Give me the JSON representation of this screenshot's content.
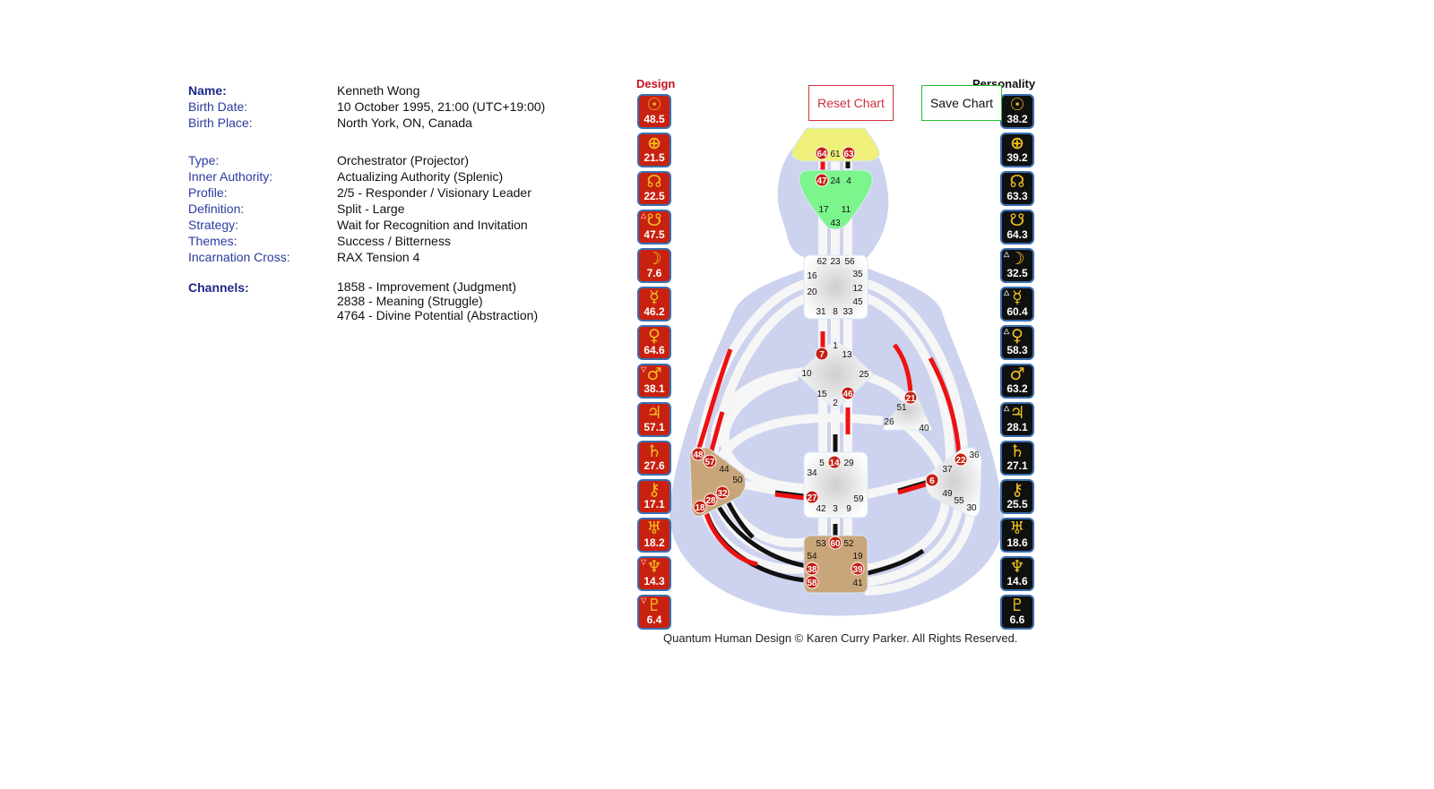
{
  "profile": {
    "name_label": "Name:",
    "name": "Kenneth Wong",
    "birth_date_label": "Birth Date:",
    "birth_date": "10 October 1995, 21:00 (UTC+19:00)",
    "birth_place_label": "Birth Place:",
    "birth_place": "North York, ON, Canada",
    "type_label": "Type:",
    "type": "Orchestrator (Projector)",
    "authority_label": "Inner Authority:",
    "authority": "Actualizing Authority (Splenic)",
    "profile_label": "Profile:",
    "profile": "2/5 - Responder / Visionary Leader",
    "definition_label": "Definition:",
    "definition": "Split - Large",
    "strategy_label": "Strategy:",
    "strategy": "Wait for Recognition and Invitation",
    "themes_label": "Themes:",
    "themes": "Success / Bitterness",
    "cross_label": "Incarnation Cross:",
    "cross": "RAX Tension 4",
    "channels_label": "Channels:",
    "channels": [
      "1858 - Improvement (Judgment)",
      "2838 - Meaning (Struggle)",
      "4764 - Divine Potential (Abstraction)"
    ]
  },
  "design": {
    "title": "Design",
    "color": "#c8210f",
    "planets": [
      {
        "name": "sun",
        "glyph": "☉",
        "value": "48.5",
        "mark": ""
      },
      {
        "name": "earth",
        "glyph": "⊕",
        "value": "21.5",
        "mark": ""
      },
      {
        "name": "north-node",
        "glyph": "☊",
        "value": "22.5",
        "mark": ""
      },
      {
        "name": "south-node",
        "glyph": "☋",
        "value": "47.5",
        "mark": "△"
      },
      {
        "name": "moon",
        "glyph": "☽",
        "value": "7.6",
        "mark": ""
      },
      {
        "name": "mercury",
        "glyph": "☿",
        "value": "46.2",
        "mark": ""
      },
      {
        "name": "venus",
        "glyph": "♀",
        "value": "64.6",
        "mark": ""
      },
      {
        "name": "mars",
        "glyph": "♂",
        "value": "38.1",
        "mark": "▽"
      },
      {
        "name": "jupiter",
        "glyph": "♃",
        "value": "57.1",
        "mark": ""
      },
      {
        "name": "saturn",
        "glyph": "♄",
        "value": "27.6",
        "mark": ""
      },
      {
        "name": "chiron",
        "glyph": "⚷",
        "value": "17.1",
        "mark": ""
      },
      {
        "name": "uranus",
        "glyph": "♅",
        "value": "18.2",
        "mark": ""
      },
      {
        "name": "neptune",
        "glyph": "♆",
        "value": "14.3",
        "mark": "▽"
      },
      {
        "name": "pluto",
        "glyph": "♇",
        "value": "6.4",
        "mark": "▽"
      }
    ]
  },
  "personality": {
    "title": "Personality",
    "color": "#101010",
    "planets": [
      {
        "name": "sun",
        "glyph": "☉",
        "value": "38.2",
        "mark": ""
      },
      {
        "name": "earth",
        "glyph": "⊕",
        "value": "39.2",
        "mark": ""
      },
      {
        "name": "north-node",
        "glyph": "☊",
        "value": "63.3",
        "mark": ""
      },
      {
        "name": "south-node",
        "glyph": "☋",
        "value": "64.3",
        "mark": ""
      },
      {
        "name": "moon",
        "glyph": "☽",
        "value": "32.5",
        "mark": "△"
      },
      {
        "name": "mercury",
        "glyph": "☿",
        "value": "60.4",
        "mark": "△"
      },
      {
        "name": "venus",
        "glyph": "♀",
        "value": "58.3",
        "mark": "△"
      },
      {
        "name": "mars",
        "glyph": "♂",
        "value": "63.2",
        "mark": ""
      },
      {
        "name": "jupiter",
        "glyph": "♃",
        "value": "28.1",
        "mark": "△"
      },
      {
        "name": "saturn",
        "glyph": "♄",
        "value": "27.1",
        "mark": ""
      },
      {
        "name": "chiron",
        "glyph": "⚷",
        "value": "25.5",
        "mark": ""
      },
      {
        "name": "uranus",
        "glyph": "♅",
        "value": "18.6",
        "mark": ""
      },
      {
        "name": "neptune",
        "glyph": "♆",
        "value": "14.6",
        "mark": ""
      },
      {
        "name": "pluto",
        "glyph": "♇",
        "value": "6.6",
        "mark": ""
      }
    ]
  },
  "buttons": {
    "reset": "Reset Chart",
    "save": "Save Chart"
  },
  "bodygraph": {
    "colors": {
      "body": "#cdd2ee",
      "head": "#eef07a",
      "ajna": "#7cf58c",
      "defined_motor": "#c9a67a",
      "undefined": "#f4f4f4",
      "design_line": "#ee1111",
      "personality_line": "#111111",
      "gate_active": "#c41f14"
    },
    "centers": [
      {
        "name": "head",
        "defined": true,
        "gates": [
          {
            "n": "64",
            "active": true
          },
          {
            "n": "61",
            "active": false
          },
          {
            "n": "63",
            "active": true
          }
        ]
      },
      {
        "name": "ajna",
        "defined": true,
        "gates": [
          {
            "n": "47",
            "active": true
          },
          {
            "n": "24",
            "active": false
          },
          {
            "n": "4",
            "active": false
          },
          {
            "n": "17",
            "active": false
          },
          {
            "n": "11",
            "active": false
          },
          {
            "n": "43",
            "active": false
          }
        ]
      },
      {
        "name": "throat",
        "defined": false,
        "gates": [
          {
            "n": "62",
            "active": false
          },
          {
            "n": "23",
            "active": false
          },
          {
            "n": "56",
            "active": false
          },
          {
            "n": "16",
            "active": false
          },
          {
            "n": "35",
            "active": false
          },
          {
            "n": "20",
            "active": false
          },
          {
            "n": "12",
            "active": false
          },
          {
            "n": "45",
            "active": false
          },
          {
            "n": "31",
            "active": false
          },
          {
            "n": "8",
            "active": false
          },
          {
            "n": "33",
            "active": false
          }
        ]
      },
      {
        "name": "g-center",
        "defined": false,
        "gates": [
          {
            "n": "1",
            "active": false
          },
          {
            "n": "7",
            "active": true
          },
          {
            "n": "13",
            "active": false
          },
          {
            "n": "10",
            "active": false
          },
          {
            "n": "25",
            "active": false
          },
          {
            "n": "15",
            "active": false
          },
          {
            "n": "46",
            "active": true
          },
          {
            "n": "2",
            "active": false
          }
        ]
      },
      {
        "name": "heart",
        "defined": false,
        "gates": [
          {
            "n": "21",
            "active": true
          },
          {
            "n": "51",
            "active": false
          },
          {
            "n": "26",
            "active": false
          },
          {
            "n": "40",
            "active": false
          }
        ]
      },
      {
        "name": "sacral",
        "defined": false,
        "gates": [
          {
            "n": "5",
            "active": false
          },
          {
            "n": "14",
            "active": true
          },
          {
            "n": "29",
            "active": false
          },
          {
            "n": "34",
            "active": false
          },
          {
            "n": "27",
            "active": true
          },
          {
            "n": "59",
            "active": false
          },
          {
            "n": "42",
            "active": false
          },
          {
            "n": "3",
            "active": false
          },
          {
            "n": "9",
            "active": false
          }
        ]
      },
      {
        "name": "spleen",
        "defined": true,
        "gates": [
          {
            "n": "48",
            "active": true
          },
          {
            "n": "57",
            "active": true
          },
          {
            "n": "44",
            "active": false
          },
          {
            "n": "50",
            "active": false
          },
          {
            "n": "32",
            "active": true
          },
          {
            "n": "28",
            "active": true
          },
          {
            "n": "18",
            "active": true
          }
        ]
      },
      {
        "name": "solar-plexus",
        "defined": false,
        "gates": [
          {
            "n": "36",
            "active": false
          },
          {
            "n": "22",
            "active": true
          },
          {
            "n": "37",
            "active": false
          },
          {
            "n": "6",
            "active": true
          },
          {
            "n": "49",
            "active": false
          },
          {
            "n": "55",
            "active": false
          },
          {
            "n": "30",
            "active": false
          }
        ]
      },
      {
        "name": "root",
        "defined": true,
        "gates": [
          {
            "n": "53",
            "active": false
          },
          {
            "n": "60",
            "active": true
          },
          {
            "n": "52",
            "active": false
          },
          {
            "n": "54",
            "active": false
          },
          {
            "n": "19",
            "active": false
          },
          {
            "n": "38",
            "active": true
          },
          {
            "n": "39",
            "active": true
          },
          {
            "n": "58",
            "active": true
          },
          {
            "n": "41",
            "active": false
          }
        ]
      }
    ]
  },
  "footer": "Quantum Human Design © Karen Curry Parker. All Rights Reserved."
}
